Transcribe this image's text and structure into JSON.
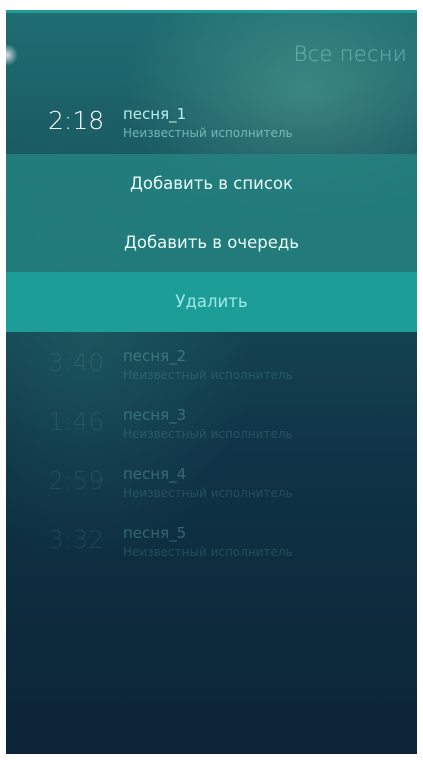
{
  "header": {
    "title": "Все песни"
  },
  "songs": [
    {
      "time": "2:18",
      "title": "песня_1",
      "artist": "Неизвестный исполнитель"
    },
    {
      "time": "3:40",
      "title": "песня_2",
      "artist": "Неизвестный исполнитель"
    },
    {
      "time": "1:46",
      "title": "песня_3",
      "artist": "Неизвестный исполнитель"
    },
    {
      "time": "2:59",
      "title": "песня_4",
      "artist": "Неизвестный исполнитель"
    },
    {
      "time": "3:32",
      "title": "песня_5",
      "artist": "Неизвестный исполнитель"
    }
  ],
  "context_menu": {
    "add_to_list": "Добавить в список",
    "add_to_queue": "Добавить в очередь",
    "delete": "Удалить"
  },
  "colors": {
    "accent": "#1d9d98",
    "highlight_text": "#b7efea"
  }
}
